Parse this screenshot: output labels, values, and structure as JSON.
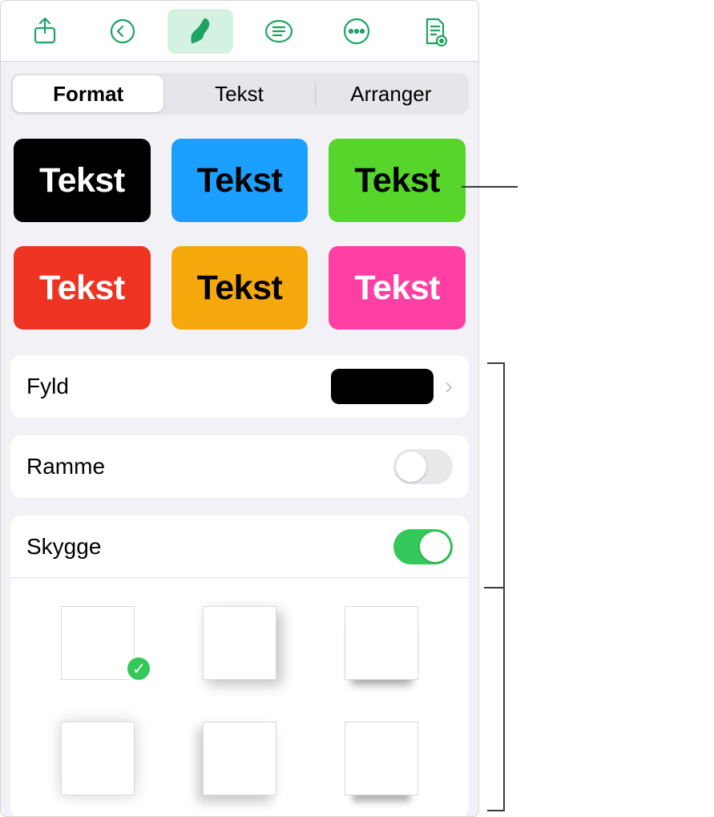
{
  "toolbar": {
    "share": "share-icon",
    "undo": "undo-icon",
    "format": "paintbrush-icon",
    "insert": "insert-icon",
    "more": "more-icon",
    "document": "document-icon"
  },
  "tabs": {
    "format": "Format",
    "text": "Tekst",
    "arrange": "Arranger",
    "selected": "format"
  },
  "text_styles": {
    "label": "Tekst",
    "items": [
      {
        "bg": "#000000",
        "fg": "#ffffff"
      },
      {
        "bg": "#1ca0ff",
        "fg": "#000000"
      },
      {
        "bg": "#56d62b",
        "fg": "#000000"
      },
      {
        "bg": "#ef3323",
        "fg": "#ffffff"
      },
      {
        "bg": "#f5a80b",
        "fg": "#000000"
      },
      {
        "bg": "#ff3fa4",
        "fg": "#ffffff"
      }
    ]
  },
  "fill": {
    "label": "Fyld",
    "color": "#000000"
  },
  "border": {
    "label": "Ramme",
    "on": false
  },
  "shadow": {
    "label": "Skygge",
    "on": true,
    "selected": 0
  }
}
